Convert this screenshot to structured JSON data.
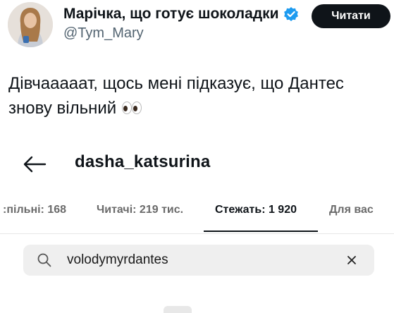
{
  "tweet": {
    "author": {
      "display_name": "Марічка, що готує шоколадки",
      "handle": "@Tym_Mary",
      "verified_icon": "verified-badge-icon",
      "avatar_icon": "user-avatar"
    },
    "follow_button_label": "Читати",
    "text": "Дівчааааат, щось мені підказує, що Дантес знову вільний",
    "emoji_icon": "eyes-emoji-icon"
  },
  "embedded_screenshot": {
    "back_icon": "back-arrow-icon",
    "profile_name": "dasha_katsurina",
    "tabs": [
      {
        "label": ":пільні: 168",
        "active": false
      },
      {
        "label": "Читачі: 219 тис.",
        "active": false
      },
      {
        "label": "Стежать: 1 920",
        "active": true
      },
      {
        "label": "Для вас",
        "active": false
      }
    ],
    "search": {
      "icon": "search-icon",
      "value": "volodymyrdantes",
      "clear_icon": "close-icon"
    }
  },
  "colors": {
    "text_primary": "#0f1419",
    "text_secondary": "#536471",
    "verified_blue": "#1d9bf0",
    "button_bg": "#0f1419",
    "search_bg": "#efefef"
  }
}
